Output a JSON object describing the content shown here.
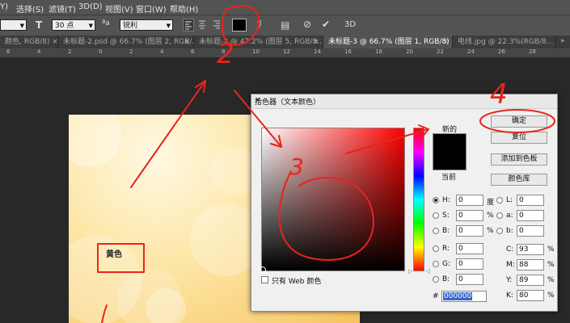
{
  "menu": {
    "items": [
      "Y)",
      "选择(S)",
      "滤镜(T)",
      "3D(D)",
      "视图(V)",
      "窗口(W)",
      "帮助(H)"
    ]
  },
  "options": {
    "font_size_label": "30 点",
    "aa_label": "a",
    "aa_mode": "锐利",
    "threed_label": "3D",
    "text_color": "#000000"
  },
  "tabs": [
    {
      "label": "颜色, RGB/8) ×"
    },
    {
      "label": "未标题-2.psd @ 66.7% (图层 2, RGB/...",
      "close": "×"
    },
    {
      "label": "未标题-2 @ 47.2% (图层 5, RGB/8...",
      "close": "×"
    },
    {
      "label": "未标题-3 @ 66.7% (图层 1, RGB/8) *",
      "close": "×"
    },
    {
      "label": "电线.jpg @ 22.3%(RGB/8...",
      "close": ""
    }
  ],
  "ruler": {
    "labels": [
      "6",
      "4",
      "2",
      "0",
      "2",
      "4",
      "6",
      "8",
      "10",
      "12",
      "14",
      "16",
      "18",
      "20",
      "22",
      "24",
      "26",
      "28"
    ]
  },
  "canvas": {
    "text": "黄色"
  },
  "color_picker": {
    "title": "拾色器（文本颜色）",
    "close": "×",
    "new_label": "新的",
    "current_label": "当前",
    "buttons": {
      "ok": "确定",
      "reset": "复位",
      "add_swatch": "添加到色板",
      "color_library": "颜色库"
    },
    "web_only": "只有 Web 颜色",
    "hsb": [
      {
        "label": "H:",
        "value": "0",
        "unit": "度",
        "selected": true
      },
      {
        "label": "S:",
        "value": "0",
        "unit": "%",
        "selected": false
      },
      {
        "label": "B:",
        "value": "0",
        "unit": "%",
        "selected": false
      }
    ],
    "lab": [
      {
        "label": "L:",
        "value": "0"
      },
      {
        "label": "a:",
        "value": "0"
      },
      {
        "label": "b:",
        "value": "0"
      }
    ],
    "rgb": [
      {
        "label": "R:",
        "value": "0"
      },
      {
        "label": "G:",
        "value": "0"
      },
      {
        "label": "B:",
        "value": "0"
      }
    ],
    "cmyk": [
      {
        "label": "C:",
        "value": "93",
        "unit": "%"
      },
      {
        "label": "M:",
        "value": "88",
        "unit": "%"
      },
      {
        "label": "Y:",
        "value": "89",
        "unit": "%"
      },
      {
        "label": "K:",
        "value": "80",
        "unit": "%"
      }
    ],
    "hex_label": "#",
    "hex": "000000",
    "new_color": "#000000"
  },
  "annotations": {
    "step2": "2",
    "step3": "3",
    "step4": "4",
    "color": "#e8241c"
  }
}
